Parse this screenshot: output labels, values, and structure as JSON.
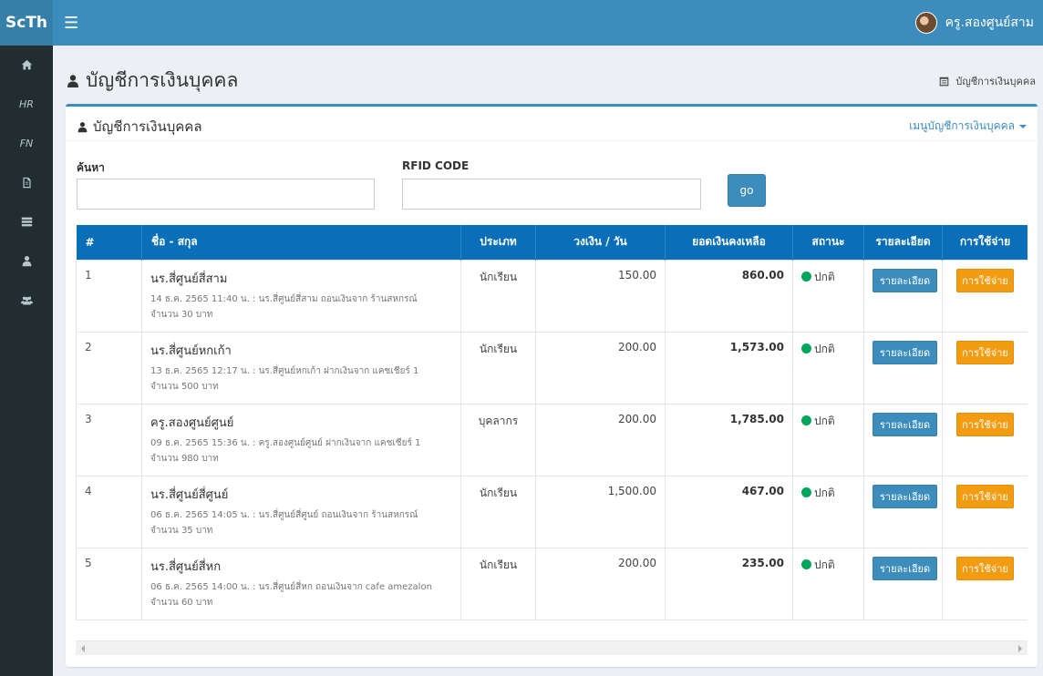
{
  "topbar": {
    "logo": "ScTh",
    "menu_icon": "hamburger-icon",
    "user_name": "ครู.สองศูนย์สาม"
  },
  "sidebar": {
    "items": [
      {
        "type": "icon",
        "icon": "home-icon"
      },
      {
        "type": "text",
        "label": "HR"
      },
      {
        "type": "text",
        "label": "FN"
      },
      {
        "type": "icon",
        "icon": "file-icon"
      },
      {
        "type": "icon",
        "icon": "list-icon"
      },
      {
        "type": "icon",
        "icon": "user-icon"
      },
      {
        "type": "icon",
        "icon": "users-icon"
      }
    ]
  },
  "header": {
    "title": "บัญชีการเงินบุคคล",
    "breadcrumb": "บัญชีการเงินบุคคล"
  },
  "box": {
    "title": "บัญชีการเงินบุคคล",
    "menu": "เมนูบัญชีการเงินบุคคล"
  },
  "search": {
    "label": "ค้นหา",
    "value": "",
    "rfid_label": "RFID CODE",
    "rfid_value": "",
    "go": "go"
  },
  "table": {
    "headers": [
      "#",
      "ชื่อ - สกุล",
      "ประเภท",
      "วงเงิน / วัน",
      "ยอดเงินคงเหลือ",
      "สถานะ",
      "รายละเอียด",
      "การใช้จ่าย"
    ],
    "rows": [
      {
        "no": "1",
        "name": "นร.สี่ศูนย์สี่สาม",
        "detail": "14 ธ.ค. 2565 11:40 น. : นร.สี่ศูนย์สี่สาม ถอนเงินจาก ร้านสหกรณ์",
        "amount": "จำนวน 30 บาท",
        "type": "นักเรียน",
        "limit": "150.00",
        "balance": "860.00",
        "status": "ปกติ",
        "detail_btn": "รายละเอียด",
        "spend_btn": "การใช้จ่าย"
      },
      {
        "no": "2",
        "name": "นร.สี่ศูนย์หกเก้า",
        "detail": "13 ธ.ค. 2565 12:17 น. : นร.สี่ศูนย์หกเก้า ฝากเงินจาก แคชเชียร์ 1",
        "amount": "จำนวน 500 บาท",
        "type": "นักเรียน",
        "limit": "200.00",
        "balance": "1,573.00",
        "status": "ปกติ",
        "detail_btn": "รายละเอียด",
        "spend_btn": "การใช้จ่าย"
      },
      {
        "no": "3",
        "name": "ครู.สองศูนย์ศูนย์",
        "detail": "09 ธ.ค. 2565 15:36 น. : ครู.สองศูนย์ศูนย์ ฝากเงินจาก แคชเชียร์ 1",
        "amount": "จำนวน 980 บาท",
        "type": "บุคลากร",
        "limit": "200.00",
        "balance": "1,785.00",
        "status": "ปกติ",
        "detail_btn": "รายละเอียด",
        "spend_btn": "การใช้จ่าย"
      },
      {
        "no": "4",
        "name": "นร.สี่ศูนย์สี่ศูนย์",
        "detail": "06 ธ.ค. 2565 14:05 น. : นร.สี่ศูนย์สี่ศูนย์ ถอนเงินจาก ร้านสหกรณ์",
        "amount": "จำนวน 35 บาท",
        "type": "นักเรียน",
        "limit": "1,500.00",
        "balance": "467.00",
        "status": "ปกติ",
        "detail_btn": "รายละเอียด",
        "spend_btn": "การใช้จ่าย"
      },
      {
        "no": "5",
        "name": "นร.สี่ศูนย์สี่หก",
        "detail": "06 ธ.ค. 2565 14:00 น. : นร.สี่ศูนย์สี่หก ถอนเงินจาก cafe amezalon",
        "amount": "จำนวน 60 บาท",
        "type": "นักเรียน",
        "limit": "200.00",
        "balance": "235.00",
        "status": "ปกติ",
        "detail_btn": "รายละเอียด",
        "spend_btn": "การใช้จ่าย"
      }
    ]
  },
  "colors": {
    "topbar": "#3c8dbc",
    "sidebar": "#222d32",
    "table_header": "#0a6fb8",
    "status_ok": "#00a65a",
    "spend_button": "#f39c12"
  }
}
